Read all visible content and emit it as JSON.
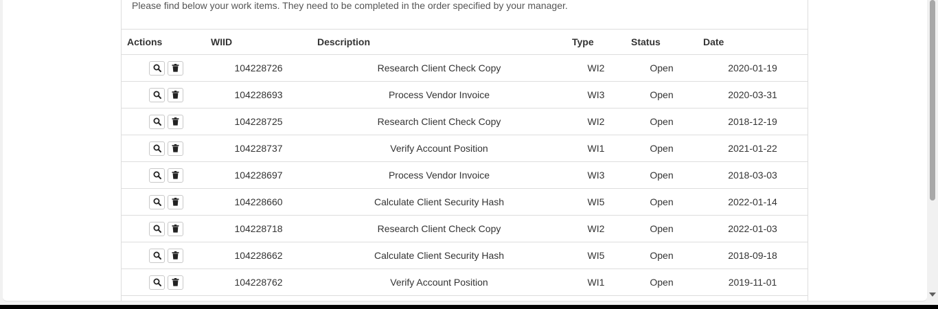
{
  "intro": "Please find below your work items. They need to be completed in the order specified by your manager.",
  "table": {
    "headers": {
      "actions": "Actions",
      "wiid": "WIID",
      "description": "Description",
      "type": "Type",
      "status": "Status",
      "date": "Date"
    },
    "rows": [
      {
        "wiid": "104228726",
        "description": "Research Client Check Copy",
        "type": "WI2",
        "status": "Open",
        "date": "2020-01-19"
      },
      {
        "wiid": "104228693",
        "description": "Process Vendor Invoice",
        "type": "WI3",
        "status": "Open",
        "date": "2020-03-31"
      },
      {
        "wiid": "104228725",
        "description": "Research Client Check Copy",
        "type": "WI2",
        "status": "Open",
        "date": "2018-12-19"
      },
      {
        "wiid": "104228737",
        "description": "Verify Account Position",
        "type": "WI1",
        "status": "Open",
        "date": "2021-01-22"
      },
      {
        "wiid": "104228697",
        "description": "Process Vendor Invoice",
        "type": "WI3",
        "status": "Open",
        "date": "2018-03-03"
      },
      {
        "wiid": "104228660",
        "description": "Calculate Client Security Hash",
        "type": "WI5",
        "status": "Open",
        "date": "2022-01-14"
      },
      {
        "wiid": "104228718",
        "description": "Research Client Check Copy",
        "type": "WI2",
        "status": "Open",
        "date": "2022-01-03"
      },
      {
        "wiid": "104228662",
        "description": "Calculate Client Security Hash",
        "type": "WI5",
        "status": "Open",
        "date": "2018-09-18"
      },
      {
        "wiid": "104228762",
        "description": "Verify Account Position",
        "type": "WI1",
        "status": "Open",
        "date": "2019-11-01"
      }
    ]
  },
  "icons": {
    "view": "search-icon",
    "delete": "trash-icon"
  }
}
